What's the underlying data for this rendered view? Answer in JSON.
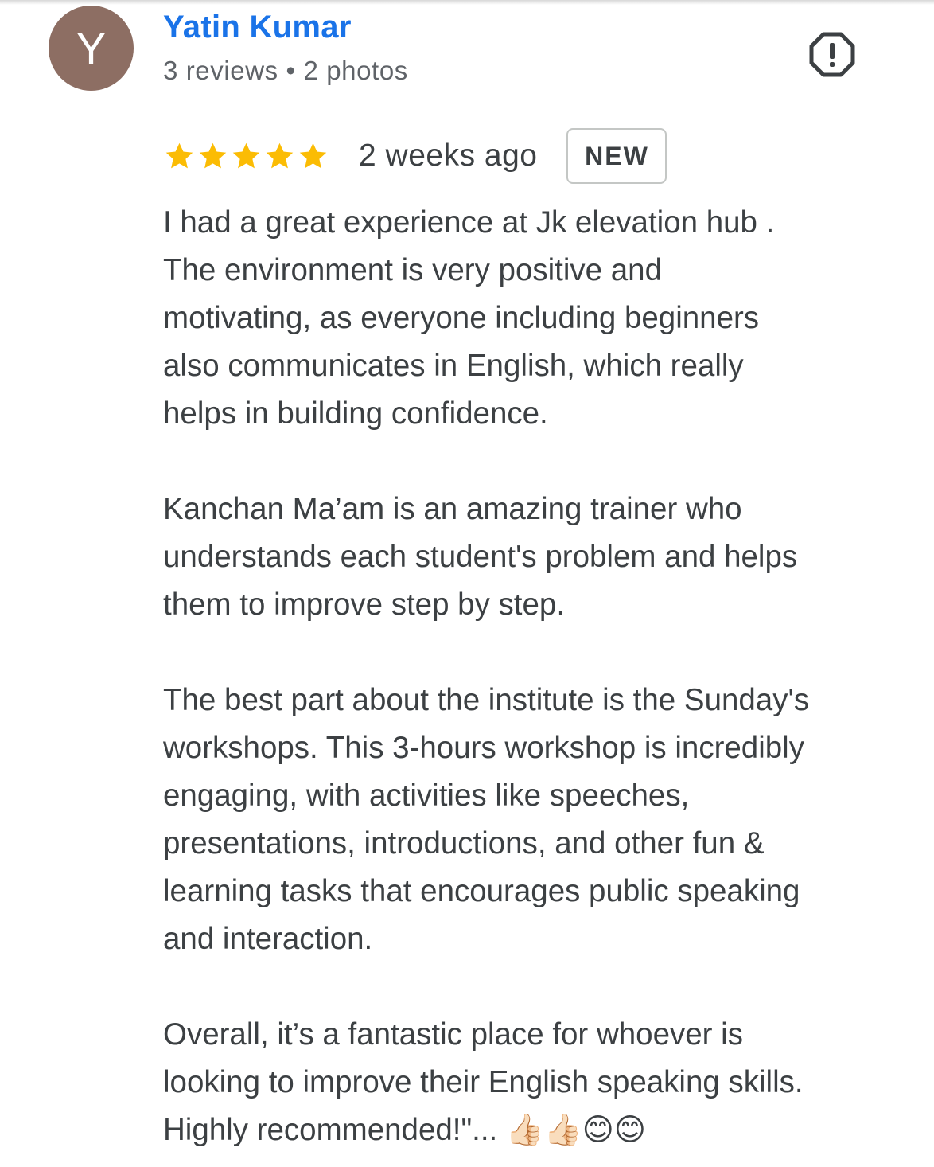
{
  "reviewer": {
    "initial": "Y",
    "name": "Yatin Kumar",
    "meta": "3 reviews • 2 photos",
    "avatar_color": "#8d6e63"
  },
  "report": {
    "icon": "report-flag-icon"
  },
  "rating": {
    "stars": 5,
    "max_stars": 5,
    "star_color": "#fbbc04",
    "time_ago": "2 weeks ago",
    "badge": "NEW"
  },
  "review": {
    "paragraphs": [
      "I had a great experience at Jk elevation hub .\nThe environment is very positive and\nmotivating, as everyone including beginners\nalso communicates in English, which really\nhelps in building confidence.",
      "Kanchan Ma’am is an amazing trainer who\nunderstands each student's problem and helps\nthem to improve step by step.",
      "The best part about the institute is the Sunday's\nworkshops. This 3-hours workshop is incredibly\nengaging, with activities like speeches,\npresentations, introductions, and other fun &\nlearning tasks that encourages public speaking\nand interaction.",
      "Overall, it’s a fantastic place for whoever is\nlooking to improve their English speaking skills.\nHighly recommended!\"... 👍🏻👍🏻😊😊"
    ]
  }
}
